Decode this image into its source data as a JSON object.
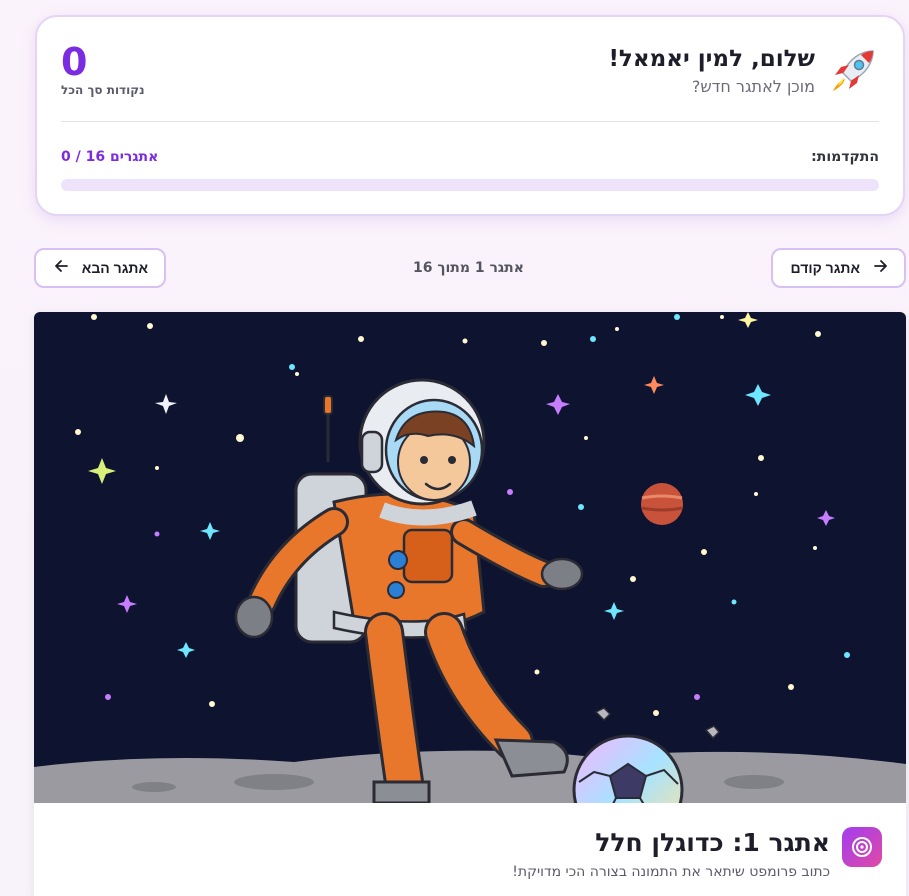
{
  "header": {
    "greeting": "שלום, למין יאמאל!",
    "subtitle": "מוכן לאתגר חדש?",
    "score": "0",
    "score_label": "נקודות סך הכל",
    "progress_label": "התקדמות:",
    "progress_count": "0 / 16 אתגרים",
    "progress_fraction": 0,
    "icon": "rocket-icon"
  },
  "navigation": {
    "prev_label": "אתגר קודם",
    "next_label": "אתגר הבא",
    "counter": "אתגר 1 מתוך 16",
    "prev_icon": "arrow-right-icon",
    "next_icon": "arrow-left-icon"
  },
  "challenge": {
    "title": "אתגר 1: כדוגלן חלל",
    "description": "כתוב פרומפט שיתאר את התמונה בצורה הכי מדויקת!",
    "icon": "target-icon",
    "image_subject": "astronaut-kicking-soccer-ball-on-moon"
  },
  "colors": {
    "accent": "#7c2ce0",
    "card_border": "#e4d4f6",
    "space_bg": "#0e1430",
    "suit": "#e8772b"
  }
}
